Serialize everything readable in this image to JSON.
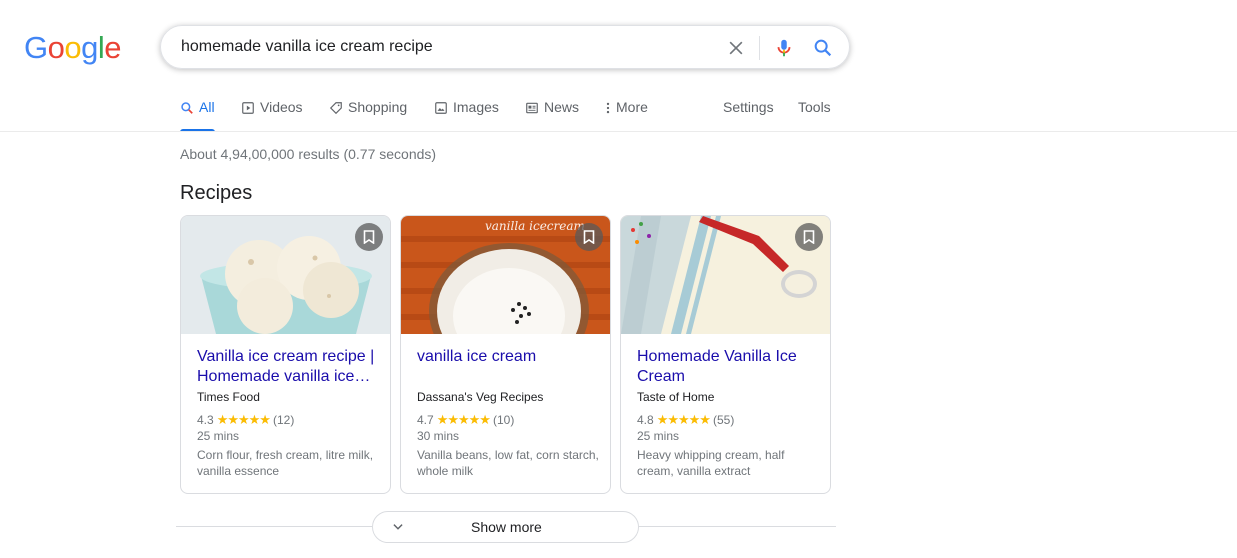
{
  "logo": {
    "letters": [
      "G",
      "o",
      "o",
      "g",
      "l",
      "e"
    ],
    "colors": [
      "#4285F4",
      "#EA4335",
      "#FBBC05",
      "#4285F4",
      "#34A853",
      "#EA4335"
    ]
  },
  "search": {
    "query": "homemade vanilla ice cream recipe"
  },
  "tabs": [
    {
      "label": "All",
      "icon": "search-icon",
      "active": true
    },
    {
      "label": "Videos",
      "icon": "play-icon"
    },
    {
      "label": "Shopping",
      "icon": "tag-icon"
    },
    {
      "label": "Images",
      "icon": "image-icon"
    },
    {
      "label": "News",
      "icon": "newspaper-icon"
    },
    {
      "label": "More",
      "icon": "more-vert-icon"
    },
    {
      "label": "Settings"
    },
    {
      "label": "Tools"
    }
  ],
  "stats": "About 4,94,00,000 results (0.77 seconds)",
  "section_title": "Recipes",
  "recipes": [
    {
      "title": "Vanilla ice cream recipe | Homemade vanilla ice…",
      "source": "Times Food",
      "rating": "4.3",
      "stars": "★★★★★",
      "reviews": "(12)",
      "time": "25 mins",
      "ingredients": "Corn flour, fresh cream, litre milk, vanilla essence"
    },
    {
      "title": "vanilla ice cream",
      "source": "Dassana's Veg Recipes",
      "rating": "4.7",
      "stars": "★★★★★",
      "reviews": "(10)",
      "time": "30 mins",
      "ingredients": "Vanilla beans, low fat, corn starch, whole milk",
      "image_caption": "vanilla icecream"
    },
    {
      "title": "Homemade Vanilla Ice Cream",
      "source": "Taste of Home",
      "rating": "4.8",
      "stars": "★★★★★",
      "reviews": "(55)",
      "time": "25 mins",
      "ingredients": "Heavy whipping cream, half cream, vanilla extract"
    }
  ],
  "show_more": "Show more",
  "colors": {
    "link": "#1a0dab",
    "accent": "#1a73e8",
    "star": "#fbbc04"
  }
}
